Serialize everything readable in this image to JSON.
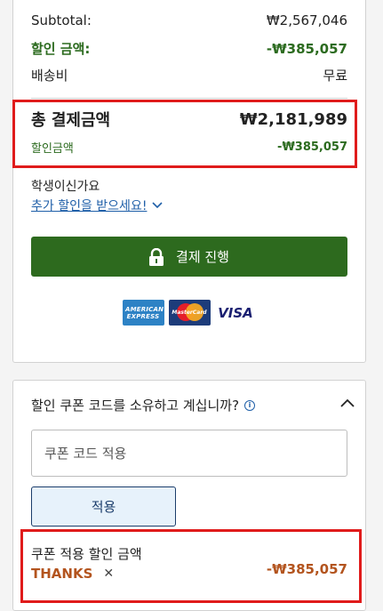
{
  "summary": {
    "subtotal_label": "Subtotal:",
    "subtotal_value": "₩2,567,046",
    "discount_label": "할인 금액:",
    "discount_value": "-₩385,057",
    "shipping_label": "배송비",
    "shipping_value": "무료",
    "total_label": "총 결제금액",
    "total_value": "₩2,181,989",
    "total_discount_label": "할인금액",
    "total_discount_value": "-₩385,057",
    "student_question": "학생이신가요",
    "student_link": "추가 할인을 받으세요!",
    "checkout_label": "결제 진행",
    "payment_methods": [
      "AMERICAN EXPRESS",
      "MasterCard",
      "VISA"
    ]
  },
  "coupon": {
    "title": "할인 쿠폰 코드를 소유하고 계십니까?",
    "info_symbol": "i",
    "input_placeholder": "쿠폰 코드 적용",
    "apply_label": "적용",
    "applied_label": "쿠폰 적용 할인 금액",
    "code": "THANKS",
    "remove_symbol": "✕",
    "amount": "-₩385,057"
  },
  "colors": {
    "accent_green": "#2d6a1e",
    "discount_green": "#2c6b1f",
    "highlight_red": "#e01b1b",
    "coupon_orange": "#b3541e",
    "link_blue": "#1f5fa8"
  }
}
